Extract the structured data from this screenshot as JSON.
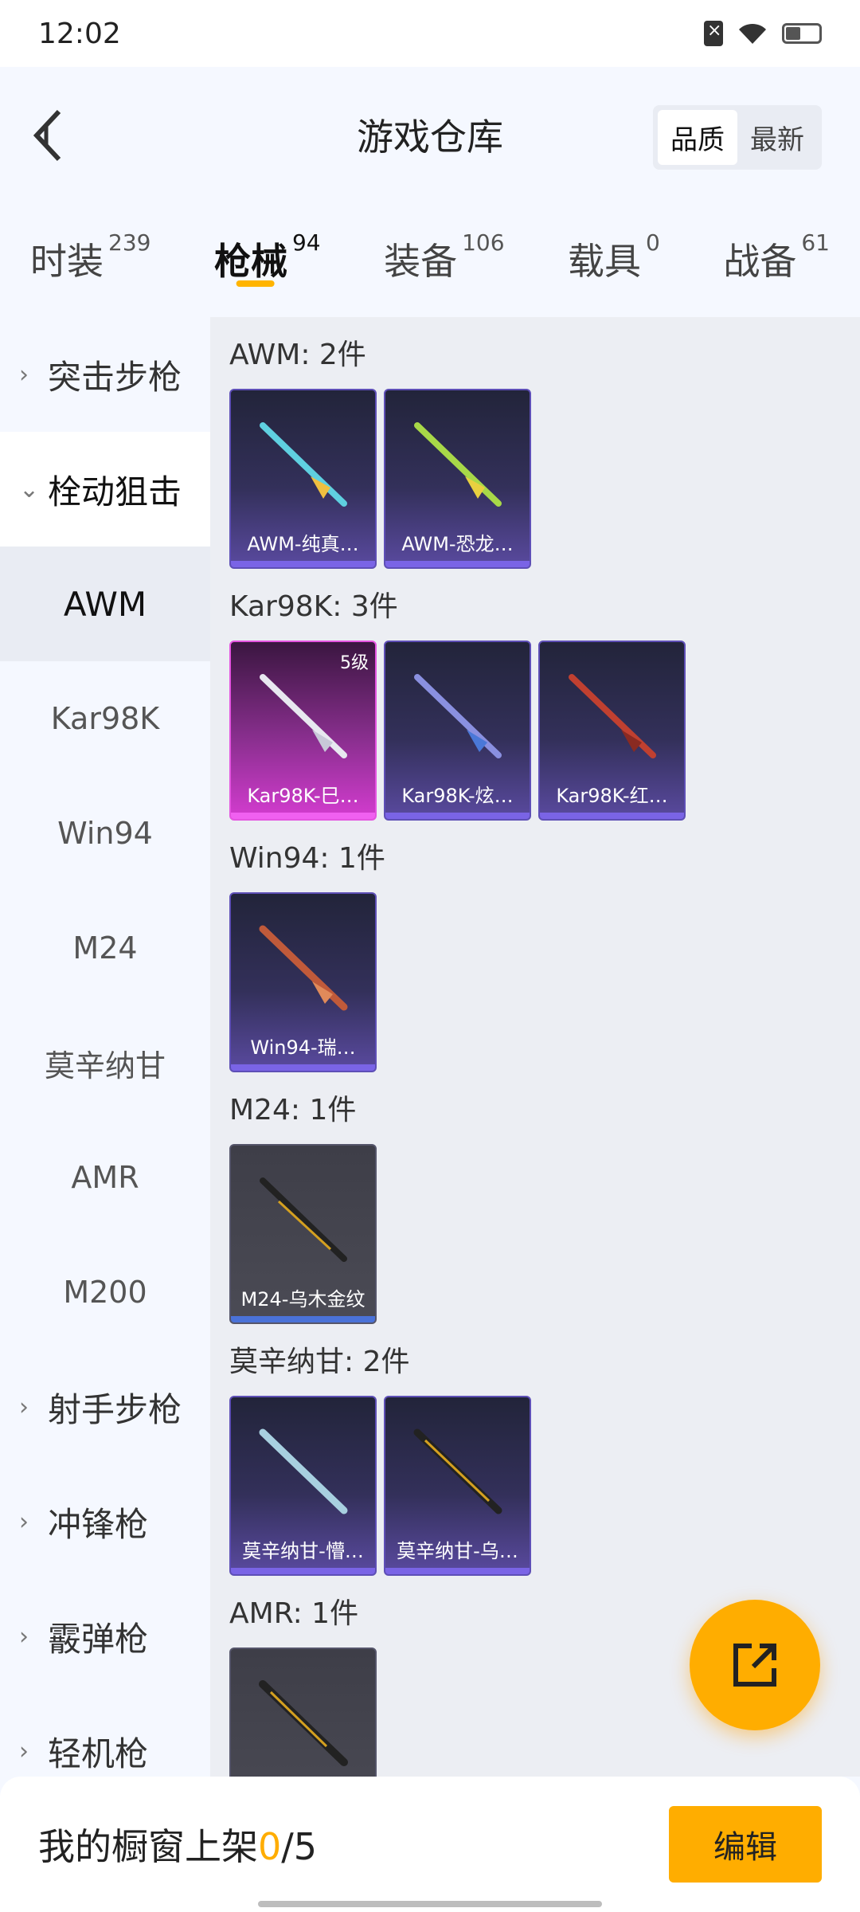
{
  "status_bar": {
    "time": "12:02"
  },
  "header": {
    "title": "游戏仓库",
    "sort_options": [
      "品质",
      "最新"
    ]
  },
  "tabs": [
    {
      "label": "时装",
      "count": "239"
    },
    {
      "label": "枪械",
      "count": "94"
    },
    {
      "label": "装备",
      "count": "106"
    },
    {
      "label": "载具",
      "count": "0"
    },
    {
      "label": "战备",
      "count": "61"
    }
  ],
  "sidebar": {
    "categories": [
      {
        "label": "突击步枪",
        "arrow": "›"
      },
      {
        "label": "栓动狙击",
        "arrow": "⌄"
      },
      {
        "label": "射手步枪",
        "arrow": "›"
      },
      {
        "label": "冲锋枪",
        "arrow": "›"
      },
      {
        "label": "霰弹枪",
        "arrow": "›"
      },
      {
        "label": "轻机枪",
        "arrow": "›"
      }
    ],
    "subitems": [
      "AWM",
      "Kar98K",
      "Win94",
      "M24",
      "莫辛纳甘",
      "AMR",
      "M200"
    ]
  },
  "groups": [
    {
      "title": "AWM: 2件",
      "cards": [
        {
          "name": "AWM-纯真…",
          "style": "purple"
        },
        {
          "name": "AWM-恐龙…",
          "style": "purple"
        }
      ]
    },
    {
      "title": "Kar98K: 3件",
      "cards": [
        {
          "name": "Kar98K-巳…",
          "style": "pink",
          "level": "5级"
        },
        {
          "name": "Kar98K-炫…",
          "style": "purple"
        },
        {
          "name": "Kar98K-红…",
          "style": "purple"
        }
      ]
    },
    {
      "title": "Win94: 1件",
      "cards": [
        {
          "name": "Win94-瑞…",
          "style": "purple"
        }
      ]
    },
    {
      "title": "M24: 1件",
      "cards": [
        {
          "name": "M24-乌木金纹",
          "style": "grey"
        }
      ]
    },
    {
      "title": "莫辛纳甘: 2件",
      "cards": [
        {
          "name": "莫辛纳甘-懵…",
          "style": "purple"
        },
        {
          "name": "莫辛纳甘-乌…",
          "style": "purple"
        }
      ]
    },
    {
      "title": "AMR: 1件",
      "cards": [
        {
          "name": "",
          "style": "grey"
        }
      ]
    }
  ],
  "bottom_bar": {
    "label": "我的橱窗上架",
    "current": "0",
    "total": "/5",
    "edit_label": "编辑"
  },
  "colors": {
    "accent": "#ffad00",
    "rare_purple": "#5e4fb6",
    "legendary_pink": "#e454e0",
    "common_grey": "#55556a"
  }
}
